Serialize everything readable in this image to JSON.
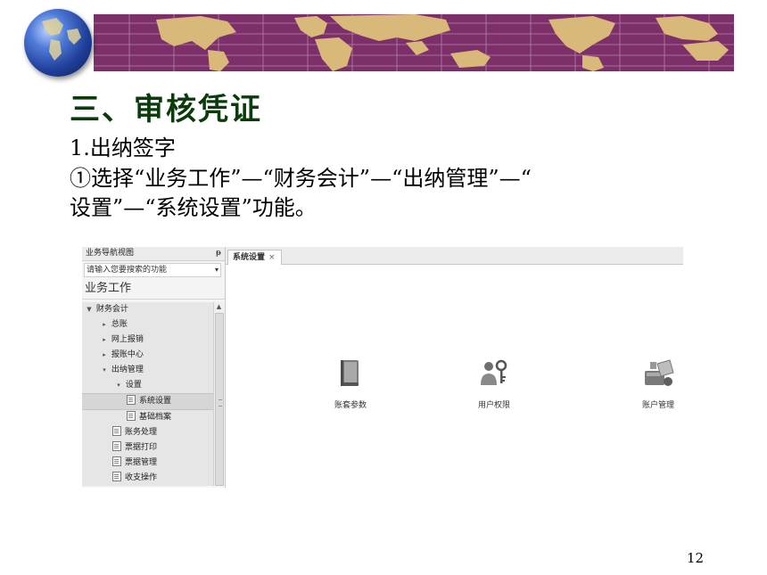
{
  "slide": {
    "title": "三、审核凭证",
    "line1": "1.出纳签字",
    "line2": "①选择“业务工作”—“财务会计”—“出纳管理”—“",
    "line3": "设置”—“系统设置”功能。",
    "page_number": "12"
  },
  "nav_panel": {
    "header": "业务导航视图",
    "pin_glyph": "ᵽ",
    "search_placeholder": "请输入您要搜索的功能",
    "section": "业务工作",
    "tree": [
      {
        "label": "财务会计",
        "twisty": "▼"
      },
      {
        "label": "总账",
        "twisty": "▸"
      },
      {
        "label": "网上报销",
        "twisty": "▸"
      },
      {
        "label": "报账中心",
        "twisty": "▸"
      },
      {
        "label": "出纳管理",
        "twisty": "▾"
      },
      {
        "label": "设置",
        "twisty": "▾"
      },
      {
        "label": "系统设置"
      },
      {
        "label": "基础档案"
      },
      {
        "label": "账务处理"
      },
      {
        "label": "票据打印"
      },
      {
        "label": "票据管理"
      },
      {
        "label": "收支操作"
      }
    ]
  },
  "content": {
    "tab_label": "系统设置",
    "tab_close": "×",
    "tools": [
      {
        "label": "账套参数",
        "icon": "book-icon"
      },
      {
        "label": "用户权限",
        "icon": "user-key-icon"
      },
      {
        "label": "账户管理",
        "icon": "account-icon"
      }
    ]
  },
  "colors": {
    "banner": "#7d2f6a",
    "land": "#d9b97a",
    "title": "#0b3b0b"
  }
}
